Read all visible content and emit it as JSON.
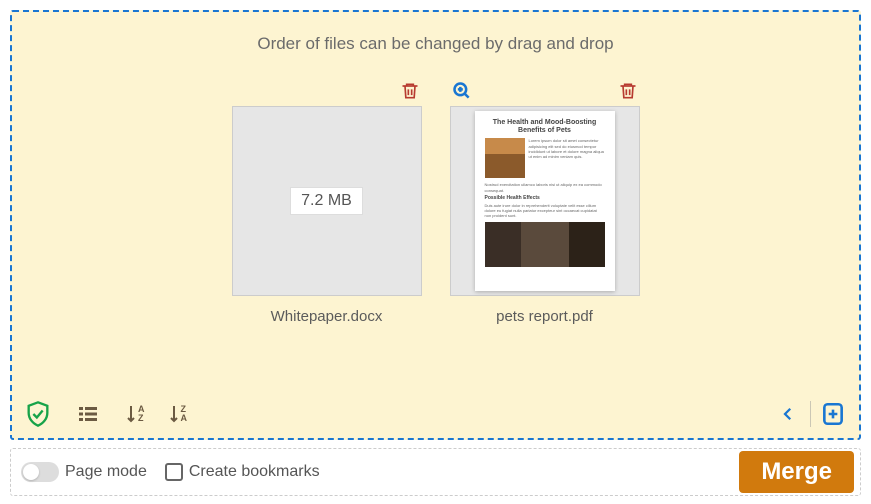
{
  "instruction": "Order of files can be changed by drag and drop",
  "files": [
    {
      "name": "Whitepaper.docx",
      "size": "7.2 MB",
      "has_preview": false
    },
    {
      "name": "pets report.pdf",
      "size": "",
      "has_preview": true
    }
  ],
  "preview_sample": {
    "title": "The Health and Mood-Boosting Benefits of Pets",
    "heading": "Possible Health Effects"
  },
  "toolbar": {
    "sort_az_top": "A",
    "sort_az_bot": "Z",
    "sort_za_top": "Z",
    "sort_za_bot": "A"
  },
  "options": {
    "page_mode_label": "Page mode",
    "create_bookmarks_label": "Create bookmarks",
    "page_mode_on": false,
    "create_bookmarks_checked": false
  },
  "actions": {
    "merge_label": "Merge"
  },
  "colors": {
    "accent_blue": "#1976d2",
    "accent_green": "#17a349",
    "accent_orange": "#d17a0d",
    "trash_red": "#b73a2f"
  }
}
